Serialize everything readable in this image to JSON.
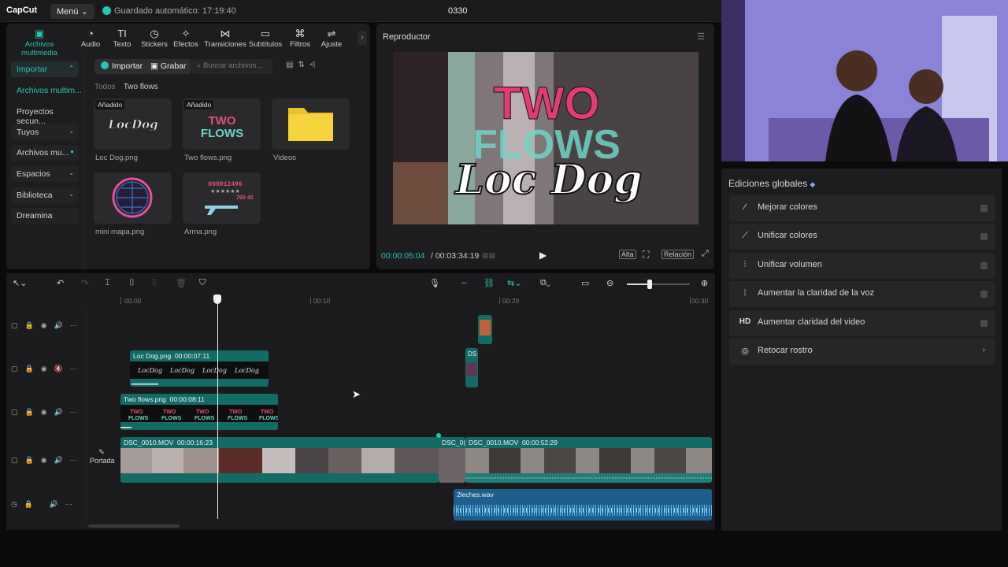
{
  "topbar": {
    "logo": "CapCut",
    "menu": "Menú ⌄",
    "autosave": "Guardado automático: 17:19:40",
    "project_title": "0330"
  },
  "toolbar": {
    "tools": [
      {
        "label": "Archivos multimedia",
        "icon": "media-icon",
        "active": true
      },
      {
        "label": "Audio",
        "icon": "audio-icon"
      },
      {
        "label": "Texto",
        "icon": "text-icon"
      },
      {
        "label": "Stickers",
        "icon": "sticker-icon"
      },
      {
        "label": "Efectos",
        "icon": "effects-icon"
      },
      {
        "label": "Transiciones",
        "icon": "transitions-icon"
      },
      {
        "label": "Subtítulos",
        "icon": "subtitles-icon"
      },
      {
        "label": "Filtros",
        "icon": "filters-icon"
      },
      {
        "label": "Ajuste",
        "icon": "adjust-icon"
      }
    ]
  },
  "sidebar": {
    "items": [
      {
        "label": "Importar"
      },
      {
        "label": "Archivos multim..."
      },
      {
        "label": "Proyectos secun..."
      },
      {
        "label": "Tuyos"
      },
      {
        "label": "Archivos mu..."
      },
      {
        "label": "Espacios"
      },
      {
        "label": "Biblioteca"
      },
      {
        "label": "Dreamina"
      }
    ]
  },
  "media": {
    "import_label": "Importar",
    "record_label": "Grabar",
    "search_placeholder": "Buscar archivos...",
    "breadcrumb": {
      "root": "Todos",
      "current": "Two flows"
    },
    "items": [
      {
        "name": "Loc Dog.png",
        "tag": "Añadido"
      },
      {
        "name": "Two flows.png",
        "tag": "Añadido"
      },
      {
        "name": "Videos",
        "tag": ""
      },
      {
        "name": "mini mapa.png",
        "tag": ""
      },
      {
        "name": "Arma.png",
        "tag": ""
      }
    ]
  },
  "player": {
    "title": "Reproductor",
    "current_time": "00:00:05:04",
    "total_time": "/ 00:03:34:19",
    "quality": "Alta",
    "ratio": "Relación",
    "graphic_lines": [
      "TWO",
      "FLOWS",
      "Loc Dog"
    ]
  },
  "timeline": {
    "ruler": [
      "00:00",
      "00:10",
      "00:20",
      "00:30"
    ],
    "cover_label": "Portada",
    "clips": {
      "loc_dog": {
        "name": "Loc Dog.png",
        "duration": "00:00:07:11"
      },
      "two_flows": {
        "name": "Two flows.png",
        "duration": "00:00:08:11"
      },
      "dsc_a": {
        "name": "DSC_0010.MOV",
        "duration": "00:00:16:23"
      },
      "dsc_b_short": {
        "name": "DSC_0("
      },
      "dsc_b": {
        "name": "DSC_0010.MOV",
        "duration": "00:00:52:29"
      },
      "ds_small": {
        "name": "DS"
      },
      "audio": {
        "name": "2leches.wav"
      }
    }
  },
  "global_edits": {
    "title": "Ediciones globales",
    "items": [
      {
        "label": "Mejorar colores",
        "icon": "wand-icon"
      },
      {
        "label": "Unificar colores",
        "icon": "palette-icon"
      },
      {
        "label": "Unificar volumen",
        "icon": "sliders-icon"
      },
      {
        "label": "Aumentar la claridad de la voz",
        "icon": "waveform-icon"
      },
      {
        "label": "Aumentar claridad del video",
        "icon": "hd-icon",
        "glyph": "HD"
      },
      {
        "label": "Retocar rostro",
        "icon": "face-retouch-icon"
      }
    ]
  },
  "colors": {
    "accent": "#27c4b5",
    "clip_teal": "#136b66",
    "audio_blue": "#1d5e8c"
  }
}
